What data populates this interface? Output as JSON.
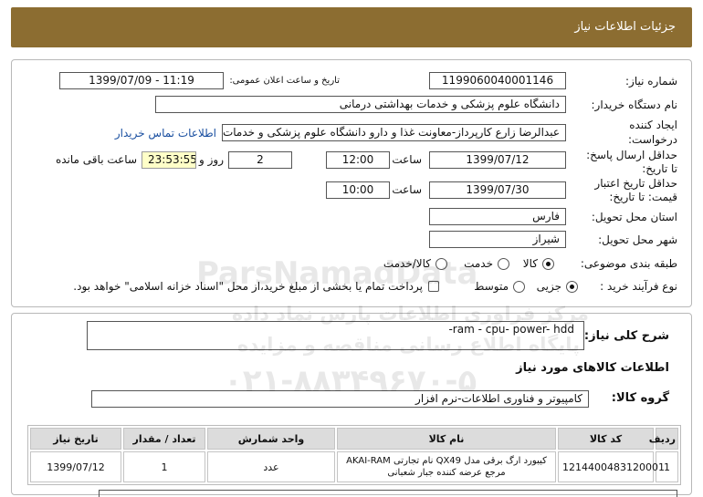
{
  "header": {
    "title": "جزئیات اطلاعات نیاز"
  },
  "need": {
    "number_label": "شماره نیاز:",
    "number": "1199060040001146",
    "announce_label": "تاریخ و ساعت اعلان عمومی:",
    "announce_datetime": "1399/07/09 - 11:19",
    "buyer_label": "نام دستگاه خریدار:",
    "buyer": "دانشگاه علوم پزشکی و خدمات بهداشتی درمانی",
    "creator_label_1": "ایجاد کننده",
    "creator_label_2": "درخواست:",
    "creator": "عبدالرضا زارع کارپرداز-معاونت غذا و دارو دانشگاه علوم پزشکی و خدمات بهداشت",
    "contact_link": "اطلاعات تماس خریدار",
    "reply_deadline": {
      "label_1": "حداقل ارسال پاسخ:",
      "label_2": "تا تاریخ:",
      "date": "1399/07/12",
      "time_label": "ساعت",
      "time": "12:00",
      "days": "2",
      "days_label": "روز و",
      "remaining": "23:53:55",
      "remaining_label": "ساعت باقی مانده"
    },
    "price_validity": {
      "label_1": "حداقل تاریخ اعتبار",
      "label_2": "قیمت: تا تاریخ:",
      "date": "1399/07/30",
      "time_label": "ساعت",
      "time": "10:00"
    },
    "province_label": "استان محل تحویل:",
    "province": "فارس",
    "city_label": "شهر محل تحویل:",
    "city": "شیراز",
    "category": {
      "label": "طبقه بندی موضوعی:",
      "options": [
        {
          "label": "کالا",
          "checked": true
        },
        {
          "label": "خدمت",
          "checked": false
        },
        {
          "label": "کالا/خدمت",
          "checked": false
        }
      ]
    },
    "process": {
      "label": "نوع فرآیند خرید :",
      "options": [
        {
          "label": "جزیی",
          "checked": true
        },
        {
          "label": "متوسط",
          "checked": false
        }
      ],
      "treasury_checked": false,
      "treasury_text": "پرداخت تمام یا بخشی از مبلغ خرید،از محل \"اسناد خزانه اسلامی\" خواهد بود."
    }
  },
  "description": {
    "label": "شرح کلی نیاز:",
    "text": "ram - cpu- power- hdd-"
  },
  "items": {
    "section_title": "اطلاعات کالاهای مورد نیاز",
    "group_label": "گروه کالا:",
    "group": "کامپیوتر و فناوری اطلاعات-نرم افزار",
    "table": {
      "headers": [
        "ردیف",
        "کد کالا",
        "نام کالا",
        "واحد شمارش",
        "تعداد / مقدار",
        "تاریخ نیاز"
      ],
      "rows": [
        {
          "row": "1",
          "code": "1214400483120001",
          "name": "کیبورد ارگ برقی مدل QX49 نام تجارتی AKAI-RAM مرجع عرضه کننده جبار شعبانی",
          "unit": "عدد",
          "quantity": "1",
          "date": "1399/07/12"
        }
      ]
    }
  },
  "watermark": {
    "brand": "ParsNamadData",
    "line1": "مرکز فراوری اطلاعات پارس نماد داده",
    "line2": "پایگاه اطلاع رسانی مناقصه و مزایده",
    "phone": "۰۲۱-۸۸۳۴۹۶۷۰-۵"
  },
  "colors": {
    "header_bg": "#8c6d31",
    "link": "#1a4fa0",
    "countdown_bg": "#ffffc8"
  }
}
